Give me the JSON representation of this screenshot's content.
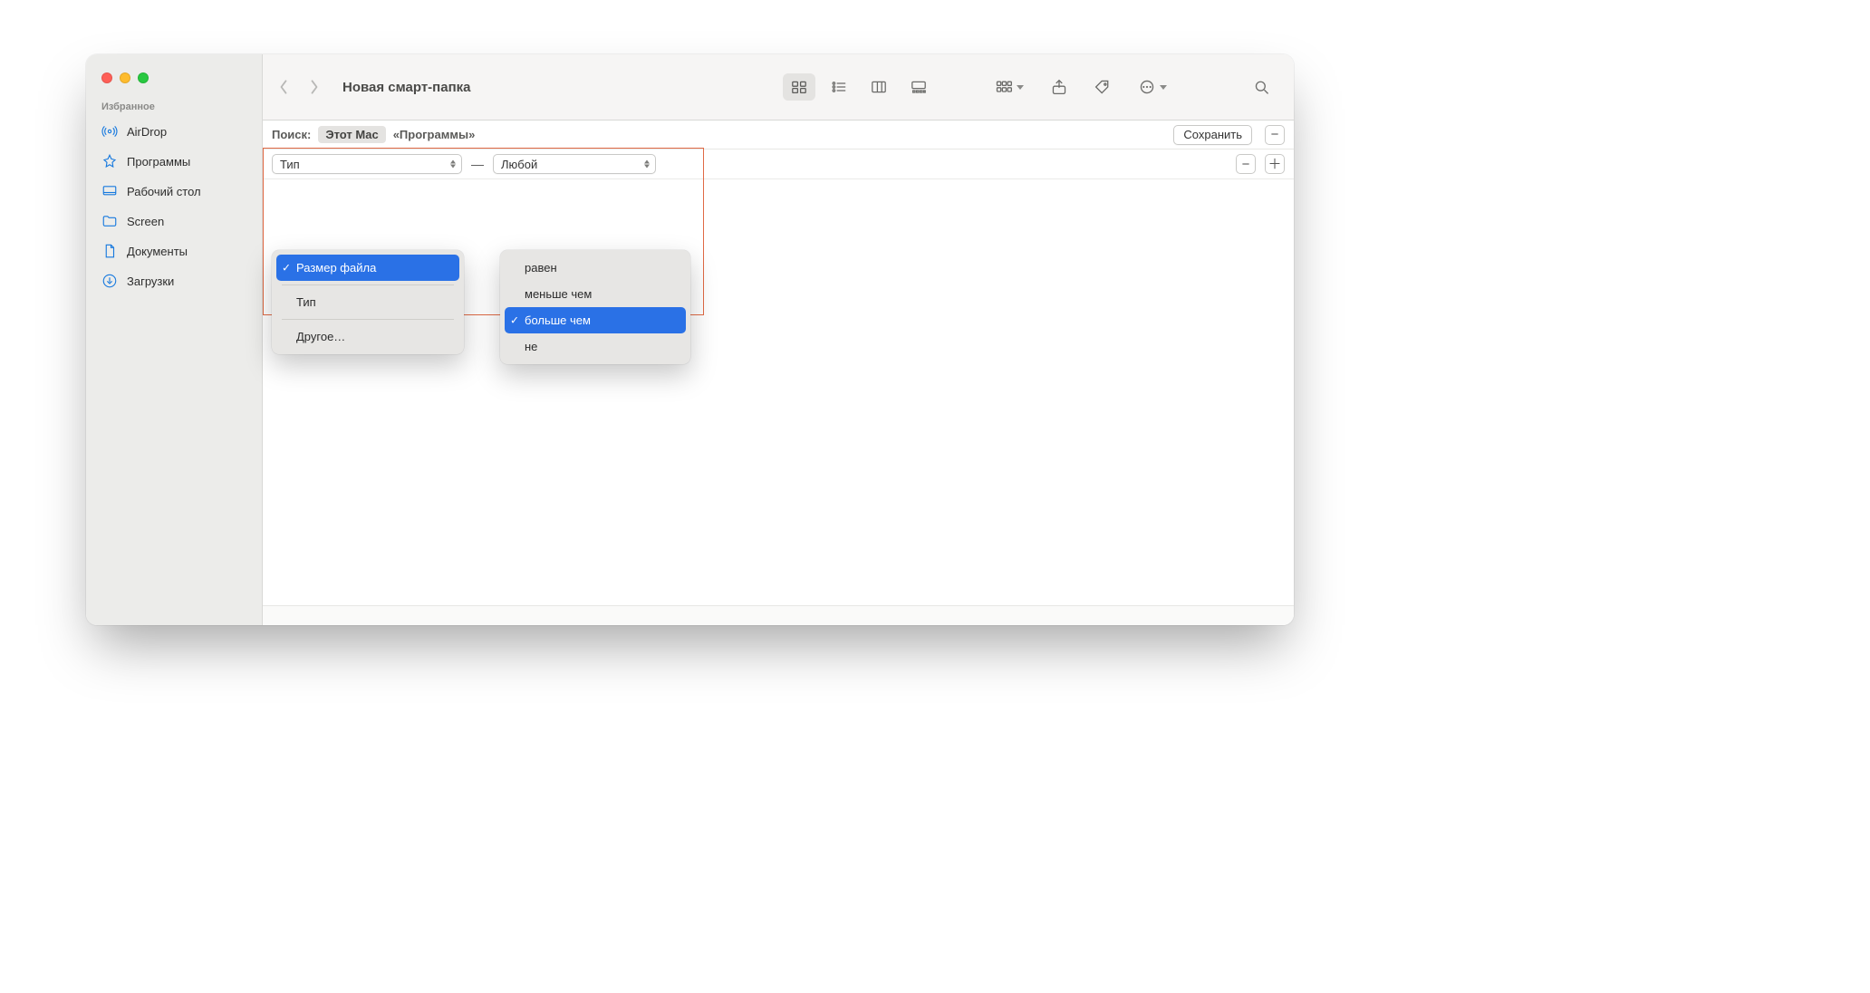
{
  "window": {
    "title": "Новая смарт-папка"
  },
  "sidebar": {
    "header": "Избранное",
    "items": [
      {
        "label": "AirDrop"
      },
      {
        "label": "Программы"
      },
      {
        "label": "Рабочий стол"
      },
      {
        "label": "Screen"
      },
      {
        "label": "Документы"
      },
      {
        "label": "Загрузки"
      }
    ]
  },
  "scope": {
    "label": "Поиск:",
    "this_mac": "Этот Mac",
    "apps": "«Программы»",
    "save": "Сохранить"
  },
  "rule": {
    "attribute_selected": "Тип",
    "separator": "—",
    "value_selected": "Любой"
  },
  "menu_attribute": {
    "items": [
      {
        "label": "Размер файла",
        "selected": true
      },
      {
        "label": "Тип"
      },
      {
        "label": "Другое…"
      }
    ]
  },
  "menu_operator": {
    "items": [
      {
        "label": "равен"
      },
      {
        "label": "меньше чем"
      },
      {
        "label": "больше чем",
        "selected": true
      },
      {
        "label": "не"
      }
    ]
  },
  "glyphs": {
    "minus": "−",
    "plus": "＋"
  }
}
